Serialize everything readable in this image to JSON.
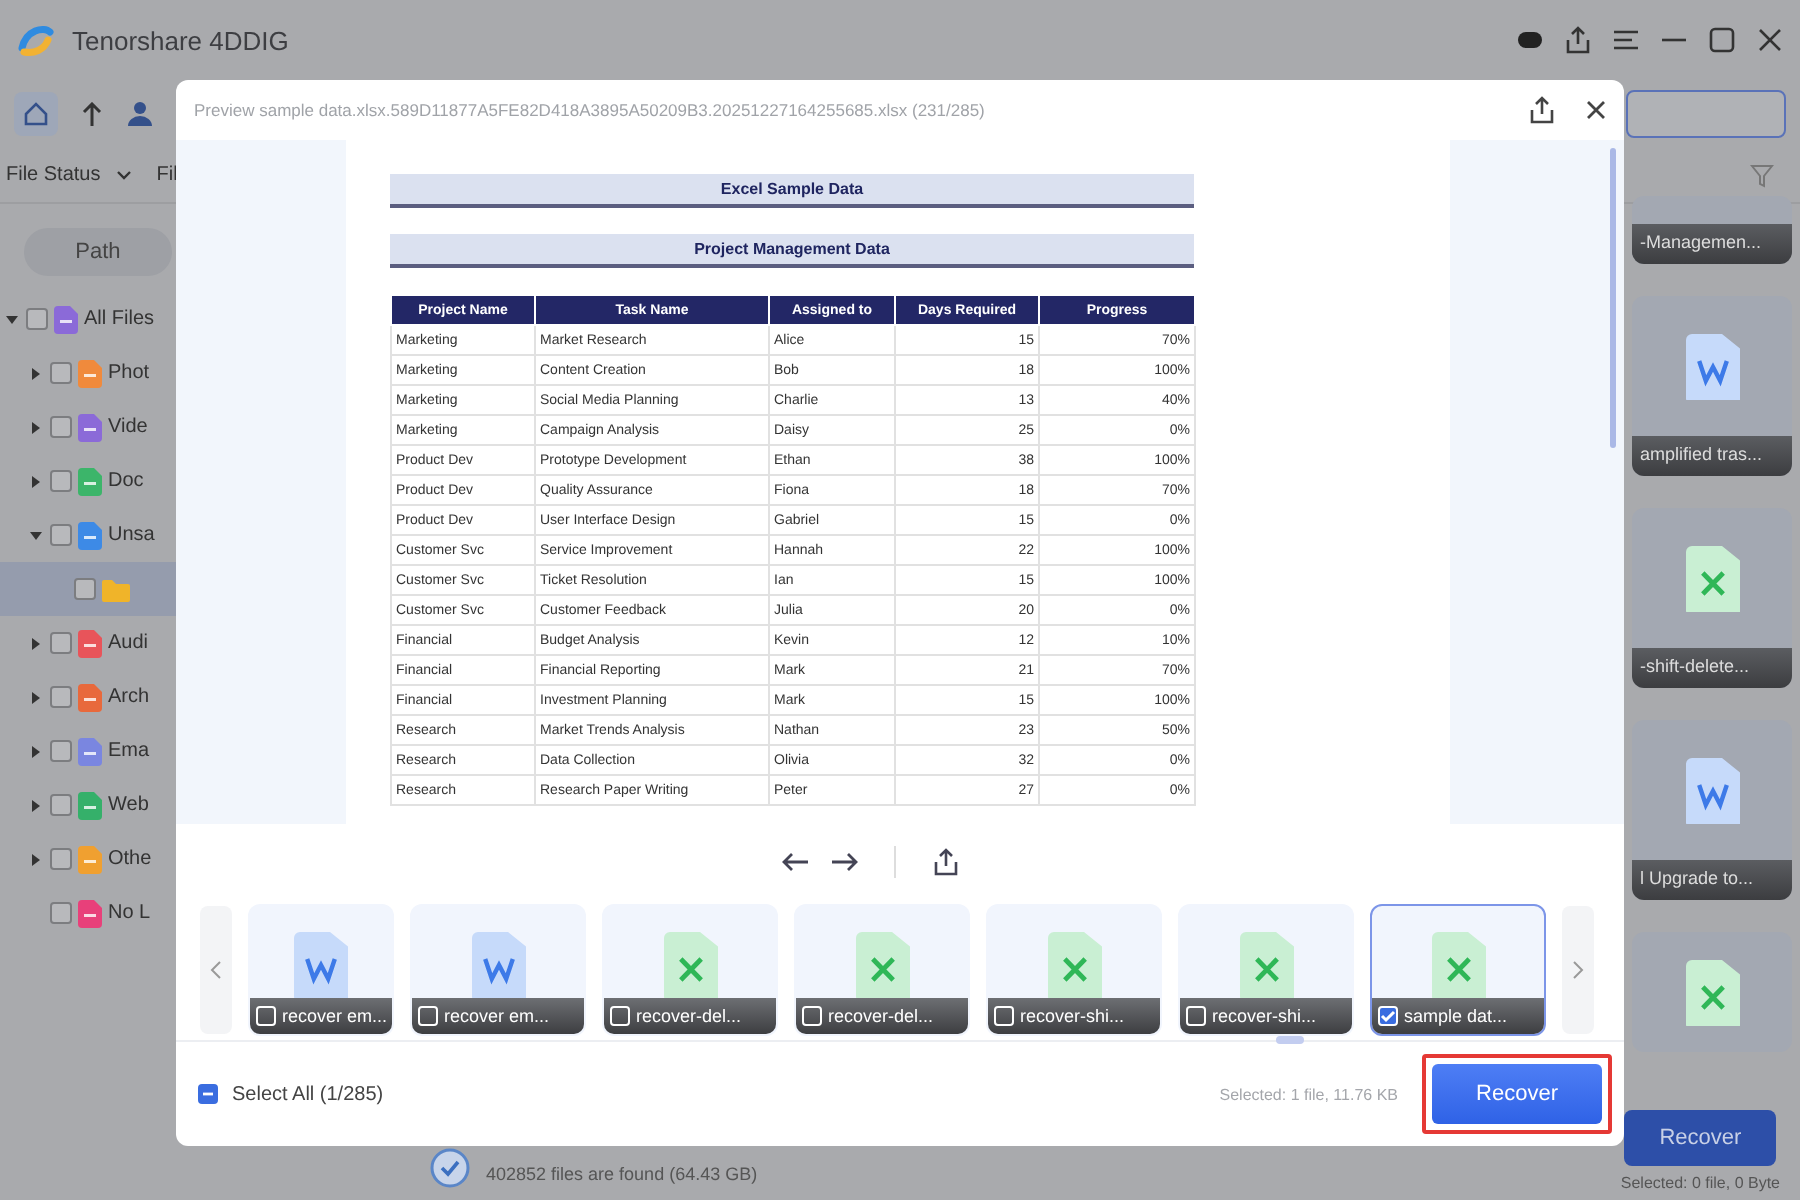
{
  "app": {
    "title": "Tenorshare 4DDIG"
  },
  "filter_bar": {
    "file_status": "File Status",
    "column_2": "Fil"
  },
  "sidebar": {
    "tab": "Path",
    "tree": [
      {
        "label": "All Files",
        "color": "#8b6ad8",
        "checked": false,
        "selected": false,
        "expandable": true,
        "expanded": true,
        "children": [
          {
            "label": "Phot",
            "color": "#f08a3c",
            "checked": false,
            "selected": false,
            "expandable": true,
            "expanded": false
          },
          {
            "label": "Vide",
            "color": "#8b6ad8",
            "checked": false,
            "selected": false,
            "expandable": true,
            "expanded": false
          },
          {
            "label": "Doc",
            "color": "#3cb56a",
            "checked": false,
            "selected": false,
            "expandable": true,
            "expanded": false
          },
          {
            "label": "Unsa",
            "color": "#3d8ae6",
            "checked": false,
            "selected": false,
            "expandable": true,
            "expanded": true,
            "children": [
              {
                "color": "#f0b429",
                "checked": false,
                "selected": true,
                "expandable": false,
                "expanded": false
              }
            ]
          },
          {
            "label": "Audi",
            "color": "#e8545a",
            "checked": false,
            "selected": false,
            "expandable": true,
            "expanded": false
          },
          {
            "label": "Arch",
            "color": "#e8693c",
            "checked": false,
            "selected": false,
            "expandable": true,
            "expanded": false
          },
          {
            "label": "Ema",
            "color": "#7a86e0",
            "checked": false,
            "selected": false,
            "expandable": true,
            "expanded": false
          },
          {
            "label": "Web",
            "color": "#35b06a",
            "checked": false,
            "selected": false,
            "expandable": true,
            "expanded": false
          },
          {
            "label": "Othe",
            "color": "#f0a030",
            "checked": false,
            "selected": false,
            "expandable": true,
            "expanded": false
          },
          {
            "label": "No L",
            "color": "#e8407a",
            "checked": false,
            "selected": false,
            "expandable": false,
            "expanded": false
          }
        ]
      }
    ]
  },
  "cards": [
    {
      "kind": "none",
      "label": "-Managemen..."
    },
    {
      "kind": "word",
      "label": "amplified tras..."
    },
    {
      "kind": "excel",
      "label": "-shift-delete..."
    },
    {
      "kind": "word",
      "label": "l Upgrade to..."
    },
    {
      "kind": "excel"
    }
  ],
  "scan_status": {
    "summary": "402852 files are found (64.43 GB)"
  },
  "footer": {
    "recover": "Recover",
    "selected": "Selected: 0 file, 0 Byte"
  },
  "preview": {
    "title": "Preview sample data.xlsx.589D11877A5FE82D418A3895A50209B3.20251227164255685.xlsx (231/285)",
    "document": {
      "title": "Excel Sample Data",
      "subtitle": "Project Management Data",
      "columns": [
        "Project Name",
        "Task Name",
        "Assigned to",
        "Days Required",
        "Progress"
      ],
      "rows": [
        [
          "Marketing",
          "Market Research",
          "Alice",
          "15",
          "70%"
        ],
        [
          "Marketing",
          "Content Creation",
          "Bob",
          "18",
          "100%"
        ],
        [
          "Marketing",
          "Social Media Planning",
          "Charlie",
          "13",
          "40%"
        ],
        [
          "Marketing",
          "Campaign Analysis",
          "Daisy",
          "25",
          "0%"
        ],
        [
          "Product Dev",
          "Prototype Development",
          "Ethan",
          "38",
          "100%"
        ],
        [
          "Product Dev",
          "Quality Assurance",
          "Fiona",
          "18",
          "70%"
        ],
        [
          "Product Dev",
          "User Interface Design",
          "Gabriel",
          "15",
          "0%"
        ],
        [
          "Customer Svc",
          "Service Improvement",
          "Hannah",
          "22",
          "100%"
        ],
        [
          "Customer Svc",
          "Ticket Resolution",
          "Ian",
          "15",
          "100%"
        ],
        [
          "Customer Svc",
          "Customer Feedback",
          "Julia",
          "20",
          "0%"
        ],
        [
          "Financial",
          "Budget Analysis",
          "Kevin",
          "12",
          "10%"
        ],
        [
          "Financial",
          "Financial Reporting",
          "Mark",
          "21",
          "70%"
        ],
        [
          "Financial",
          "Investment Planning",
          "Mark",
          "15",
          "100%"
        ],
        [
          "Research",
          "Market Trends Analysis",
          "Nathan",
          "23",
          "50%"
        ],
        [
          "Research",
          "Data Collection",
          "Olivia",
          "32",
          "0%"
        ],
        [
          "Research",
          "Research Paper Writing",
          "Peter",
          "27",
          "0%"
        ]
      ]
    },
    "thumbnails": [
      {
        "kind": "word",
        "label": "recover em...",
        "checked": false,
        "selected": false
      },
      {
        "kind": "word",
        "label": "recover em...",
        "checked": false,
        "selected": false
      },
      {
        "kind": "excel",
        "label": "recover-del...",
        "checked": false,
        "selected": false
      },
      {
        "kind": "excel",
        "label": "recover-del...",
        "checked": false,
        "selected": false
      },
      {
        "kind": "excel",
        "label": "recover-shi...",
        "checked": false,
        "selected": false
      },
      {
        "kind": "excel",
        "label": "recover-shi...",
        "checked": false,
        "selected": false
      },
      {
        "kind": "excel",
        "label": "sample dat...",
        "checked": true,
        "selected": true
      }
    ],
    "select_all": {
      "label": "Select All (1/285)",
      "indeterminate": true
    },
    "selection_info": "Selected: 1 file, 11.76 KB",
    "recover": "Recover",
    "recover_highlighted": true
  }
}
